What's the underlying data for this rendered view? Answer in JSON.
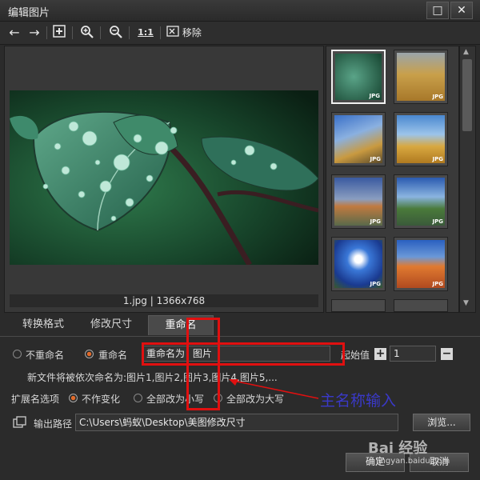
{
  "window": {
    "title": "编辑图片"
  },
  "toolbar": {
    "remove_label": "移除",
    "actual_size_label": "1:1"
  },
  "preview": {
    "caption": "1.jpg | 1366x768"
  },
  "thumbnails": {
    "badge": "JPG"
  },
  "tabs": [
    {
      "label": "转换格式"
    },
    {
      "label": "修改尺寸"
    },
    {
      "label": "重命名"
    }
  ],
  "rename": {
    "option_no_rename": "不重命名",
    "option_rename": "重命名",
    "rename_as_label": "重命名为",
    "name_value": "图片",
    "start_label": "起始值",
    "start_value": "1",
    "preview_text": "新文件将被依次命名为:图片1,图片2,图片3,图片4,图片5,..."
  },
  "extension": {
    "label": "扩展名选项",
    "no_change": "不作变化",
    "lowercase": "全部改为小写",
    "uppercase": "全部改为大写"
  },
  "output": {
    "label": "输出路径",
    "path": "C:\\Users\\蚂蚁\\Desktop\\美图修改尺寸",
    "browse_label": "浏览..."
  },
  "footer": {
    "ok_label": "确定",
    "cancel_label": "取消"
  },
  "annotation": {
    "text": "主名称输入"
  },
  "watermark": {
    "text": "Bai 经验",
    "url": "jingyan.baidu.com"
  },
  "colors": {
    "accent": "#e06a2a",
    "annotation_red": "#e01010",
    "annotation_blue": "#3a39c8"
  }
}
